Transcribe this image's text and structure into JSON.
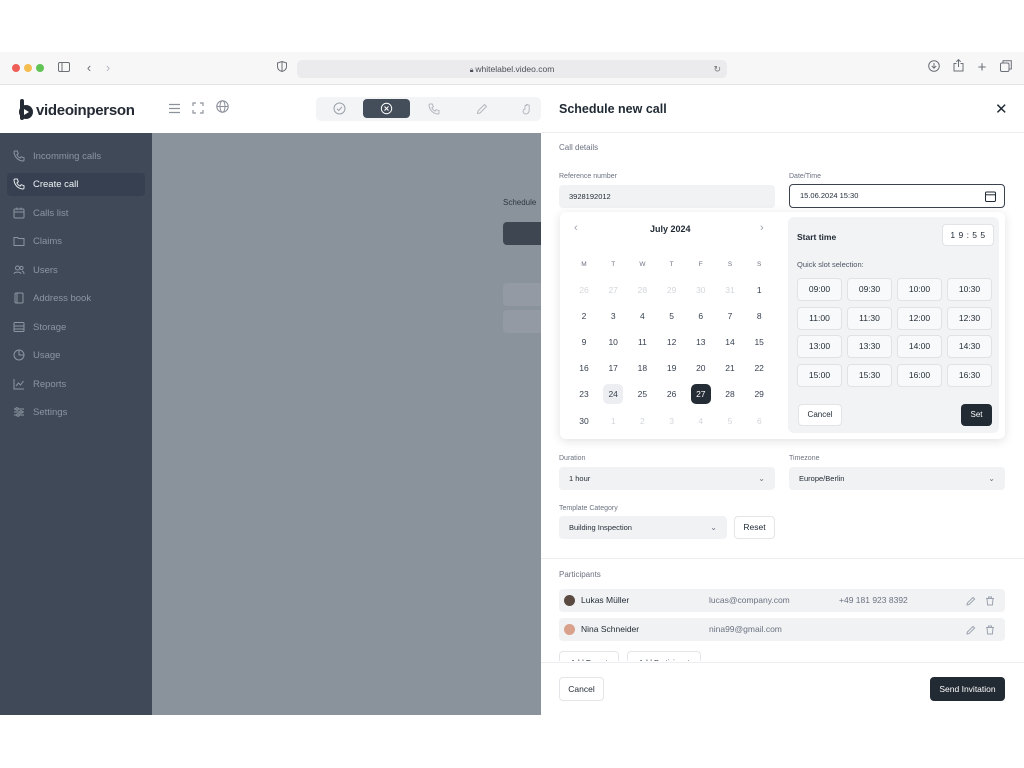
{
  "browser": {
    "url": "whitelabel.video.com"
  },
  "app": {
    "logo_text": "videoinperson",
    "sidebar": [
      {
        "label": "Incomming calls",
        "icon": "phone-incoming-icon"
      },
      {
        "label": "Create call",
        "icon": "phone-outgoing-icon",
        "active": true
      },
      {
        "label": "Calls list",
        "icon": "calendar-icon"
      },
      {
        "label": "Claims",
        "icon": "folder-icon"
      },
      {
        "label": "Users",
        "icon": "users-icon"
      },
      {
        "label": "Address book",
        "icon": "book-icon"
      },
      {
        "label": "Storage",
        "icon": "storage-icon"
      },
      {
        "label": "Usage",
        "icon": "pie-chart-icon"
      },
      {
        "label": "Reports",
        "icon": "chart-line-icon"
      },
      {
        "label": "Settings",
        "icon": "sliders-icon"
      }
    ],
    "behind_text": "Schedule"
  },
  "drawer": {
    "title": "Schedule new call",
    "section_details": "Call details",
    "ref_label": "Reference number",
    "ref_value": "3928192012",
    "datetime_label": "Date/Time",
    "datetime_value": "15.06.2024 15:30",
    "calendar": {
      "month": "July 2024",
      "weekdays": [
        "M",
        "T",
        "W",
        "T",
        "F",
        "S",
        "S"
      ],
      "weeks": [
        [
          [
            "26",
            "m"
          ],
          [
            "27",
            "m"
          ],
          [
            "28",
            "m"
          ],
          [
            "29",
            "m"
          ],
          [
            "30",
            "m"
          ],
          [
            "31",
            "m"
          ],
          [
            "1",
            ""
          ]
        ],
        [
          [
            "2",
            ""
          ],
          [
            "3",
            ""
          ],
          [
            "4",
            ""
          ],
          [
            "5",
            ""
          ],
          [
            "6",
            ""
          ],
          [
            "7",
            ""
          ],
          [
            "8",
            ""
          ]
        ],
        [
          [
            "9",
            ""
          ],
          [
            "10",
            ""
          ],
          [
            "11",
            ""
          ],
          [
            "12",
            ""
          ],
          [
            "13",
            ""
          ],
          [
            "14",
            ""
          ],
          [
            "15",
            ""
          ]
        ],
        [
          [
            "16",
            ""
          ],
          [
            "17",
            ""
          ],
          [
            "18",
            ""
          ],
          [
            "19",
            ""
          ],
          [
            "20",
            ""
          ],
          [
            "21",
            ""
          ],
          [
            "22",
            ""
          ]
        ],
        [
          [
            "23",
            ""
          ],
          [
            "24",
            "today"
          ],
          [
            "25",
            ""
          ],
          [
            "26",
            ""
          ],
          [
            "27",
            "sel"
          ],
          [
            "28",
            ""
          ],
          [
            "29",
            ""
          ]
        ],
        [
          [
            "30",
            ""
          ],
          [
            "1",
            "m"
          ],
          [
            "2",
            "m"
          ],
          [
            "3",
            "m"
          ],
          [
            "4",
            "m"
          ],
          [
            "5",
            "m"
          ],
          [
            "6",
            "m"
          ]
        ]
      ]
    },
    "time": {
      "start_label": "Start time",
      "value": "1 9 : 5 5",
      "quick_label": "Quick slot selection:",
      "slots": [
        "09:00",
        "09:30",
        "10:00",
        "10:30",
        "11:00",
        "11:30",
        "12:00",
        "12:30",
        "13:00",
        "13:30",
        "14:00",
        "14:30",
        "15:00",
        "15:30",
        "16:00",
        "16:30"
      ],
      "cancel": "Cancel",
      "set": "Set"
    },
    "duration_label": "Duration",
    "duration_value": "1 hour",
    "timezone_label": "Timezone",
    "timezone_value": "Europe/Berlin",
    "template_label": "Template Category",
    "template_value": "Building Inspection",
    "reset": "Reset",
    "participants_label": "Participants",
    "participants": [
      {
        "name": "Lukas Müller",
        "email": "lucas@company.com",
        "phone": "+49 181 923 8392"
      },
      {
        "name": "Nina Schneider",
        "email": "nina99@gmail.com",
        "phone": ""
      }
    ],
    "add_expert": "Add Expert",
    "add_participant": "Add Participant",
    "footer_cancel": "Cancel",
    "send": "Send Invitation"
  },
  "colors": {
    "sidebar": "#3f4957",
    "dark": "#222a33",
    "overlay": "#8a929c"
  }
}
